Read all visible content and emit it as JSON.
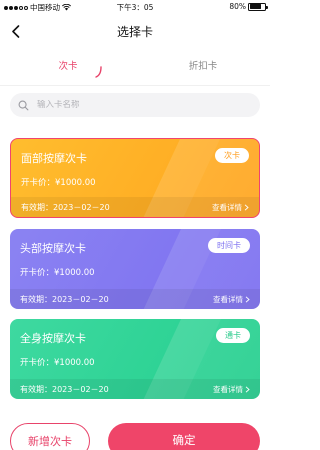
{
  "status_bar": {
    "carrier": "中国移动",
    "time": "下午3：05",
    "battery": "80%",
    "battery_level": 0.8
  },
  "header": {
    "title": "选择卡"
  },
  "tabs": [
    {
      "label": "次卡"
    },
    {
      "label": "折扣卡"
    }
  ],
  "search": {
    "placeholder": "输入卡名称"
  },
  "cards": [
    {
      "name": "面部按摩次卡",
      "badge": "次卡",
      "price": "开卡价：¥1000.00",
      "expiry": "有效期：2023－02－20",
      "detail": "查看详情"
    },
    {
      "name": "头部按摩次卡",
      "badge": "时间卡",
      "price": "开卡价：¥1000.00",
      "expiry": "有效期：2023－02－20",
      "detail": "查看详情"
    },
    {
      "name": "全身按摩次卡",
      "badge": "通卡",
      "price": "开卡价：¥1000.00",
      "expiry": "有效期：2023－02－20",
      "detail": "查看详情"
    }
  ],
  "actions": {
    "add_label": "新增次卡",
    "confirm_label": "确定"
  },
  "colors": {
    "accent": "#ef4569",
    "card_orange": "#ffa51f",
    "card_purple": "#7b6ef0",
    "card_green": "#24cf8e"
  }
}
